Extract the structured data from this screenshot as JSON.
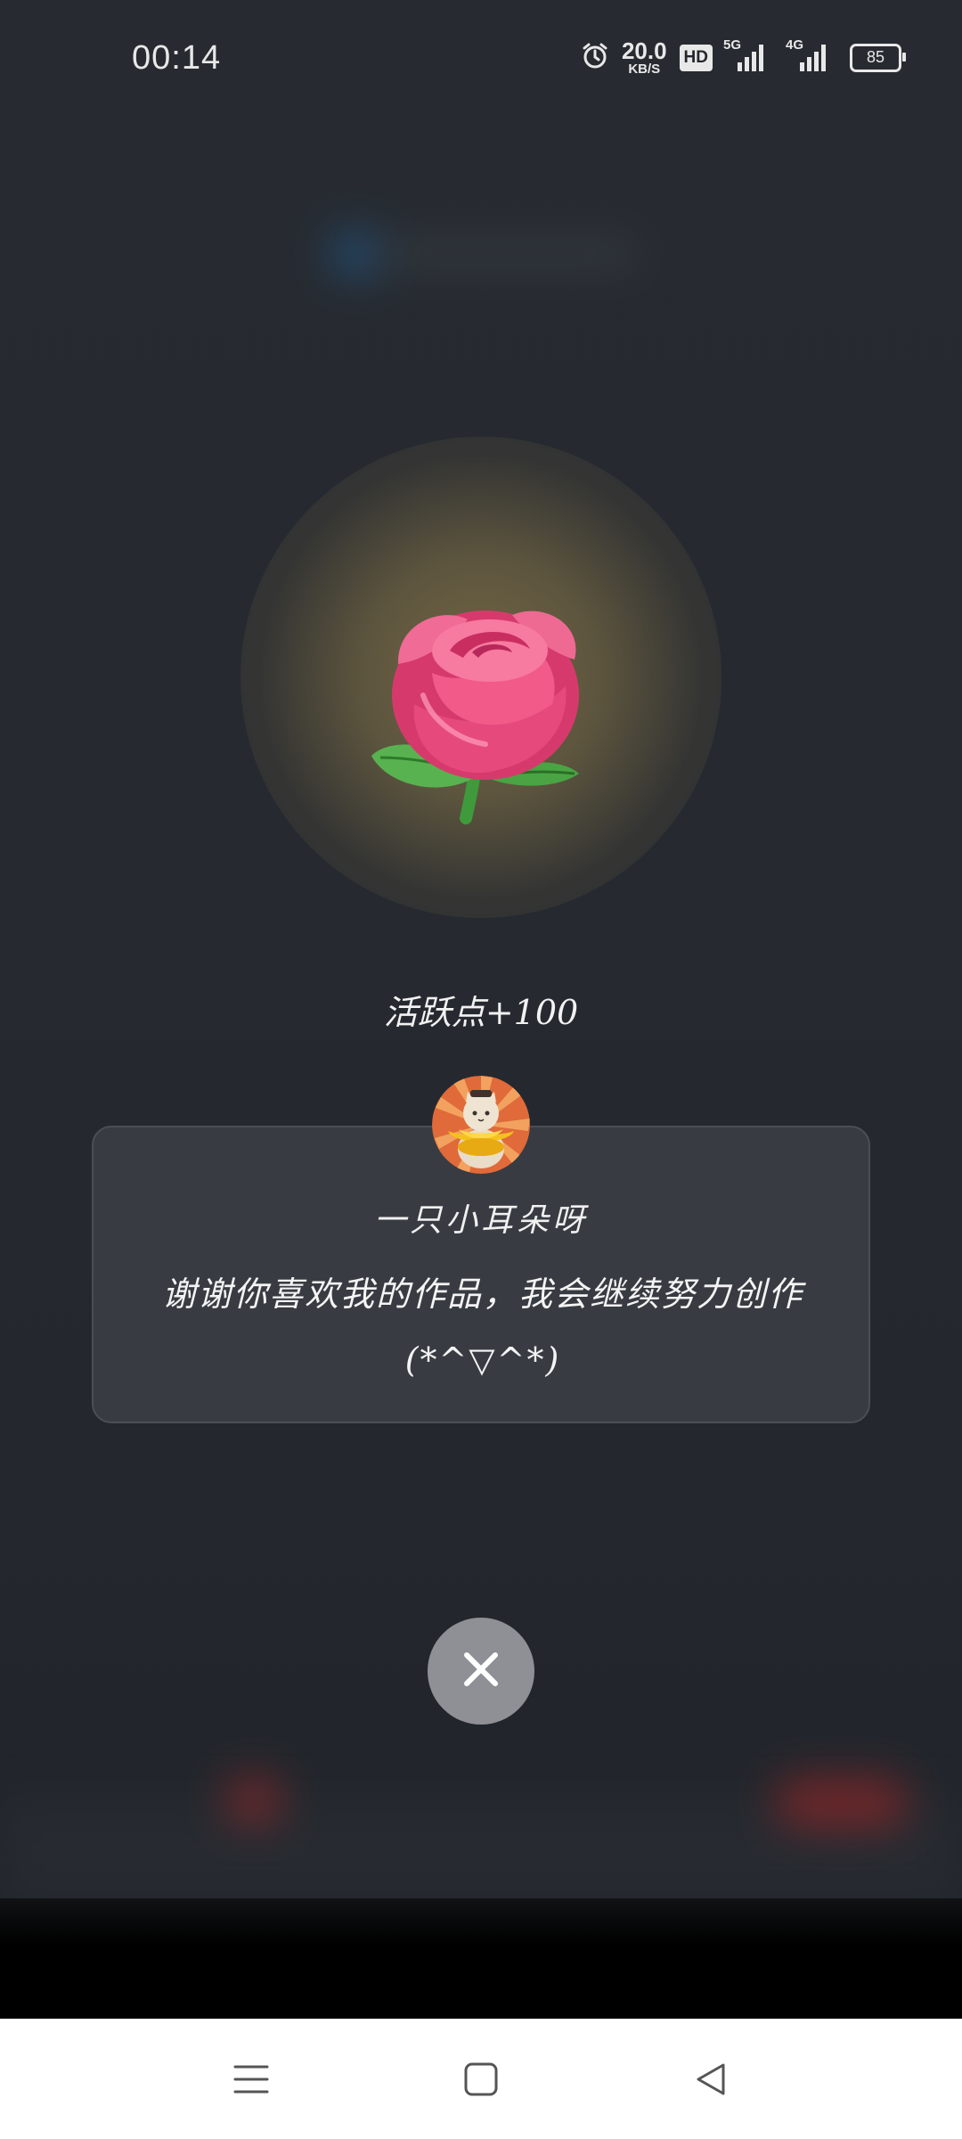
{
  "status_bar": {
    "time": "00:14",
    "net_speed_value": "20.0",
    "net_speed_unit": "KB/S",
    "hd_label": "HD",
    "signal_1_label": "5G",
    "signal_2_label": "4G",
    "battery_level": "85",
    "icons": [
      "alarm-icon",
      "hd-icon",
      "signal-5g-icon",
      "signal-4g-icon",
      "battery-icon"
    ]
  },
  "gift": {
    "icon": "rose-icon",
    "active_points_text": "活跃点+100"
  },
  "message_card": {
    "sender_name": "一只小耳朵呀",
    "message": "谢谢你喜欢我的作品，我会继续努力创作(*^▽^*)"
  },
  "close_button": {
    "icon": "close-icon"
  },
  "nav_bar": {
    "icons": [
      "menu-icon",
      "home-icon",
      "back-icon"
    ]
  },
  "colors": {
    "background": "#262a30",
    "card": "#383c42",
    "glow": "#786a46",
    "close_button": "#8e9095",
    "rose_pink": "#e84a7c",
    "nav_bar": "#ffffff"
  }
}
